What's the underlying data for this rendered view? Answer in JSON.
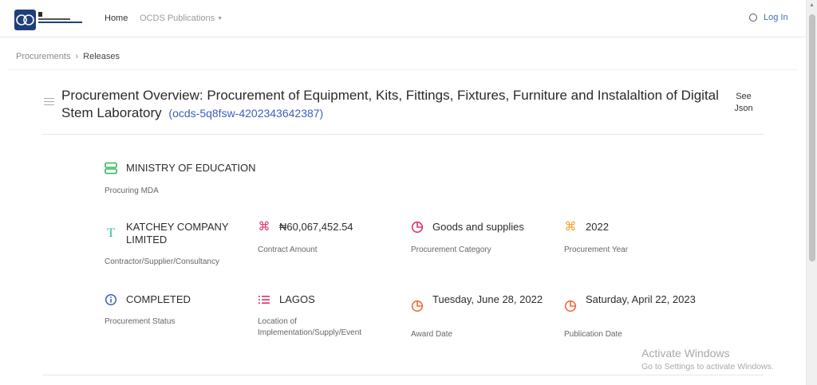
{
  "nav": {
    "home": "Home",
    "ocds": "OCDS Publications",
    "login": "Log In"
  },
  "breadcrumb": {
    "first": "Procurements",
    "current": "Releases"
  },
  "header": {
    "title": "Procurement Overview: Procurement of Equipment, Kits, Fittings, Fixtures, Furniture and Instalaltion of Digital Stem Laboratory",
    "ocid": "(ocds-5q8fsw-4202343642387)",
    "see_json": "See Json"
  },
  "details": {
    "mda": {
      "value": "MINISTRY OF EDUCATION",
      "label": "Procuring MDA",
      "icon": "server-icon",
      "color": "#2eb85c"
    },
    "contractor": {
      "value": "KATCHEY COMPANY LIMITED",
      "label": "Contractor/Supplier/Consultancy",
      "icon": "text-icon",
      "color": "#2eb8a0"
    },
    "amount": {
      "value": "₦60,067,452.54",
      "label": "Contract Amount",
      "icon": "command-icon",
      "color": "#e0316e"
    },
    "category": {
      "value": "Goods and supplies",
      "label": "Procurement Category",
      "icon": "pie-chart-icon",
      "color": "#e0316e"
    },
    "year": {
      "value": "2022",
      "label": "Procurement Year",
      "icon": "command-icon",
      "color": "#f7a024"
    },
    "status": {
      "value": "COMPLETED",
      "label": "Procurement Status",
      "icon": "info-icon",
      "color": "#3b5fbf"
    },
    "location": {
      "value": "LAGOS",
      "label": "Location of Implementation/Supply/Event",
      "icon": "list-icon",
      "color": "#e0316e"
    },
    "award": {
      "value": "Tuesday, June 28, 2022",
      "label": "Award Date",
      "icon": "pie-chart-icon",
      "color": "#f26b3a"
    },
    "publication": {
      "value": "Saturday, April 22, 2023",
      "label": "Publication Date",
      "icon": "pie-chart-icon",
      "color": "#f26b3a"
    }
  },
  "watermark": {
    "line1": "Activate Windows",
    "line2": "Go to Settings to activate Windows."
  }
}
